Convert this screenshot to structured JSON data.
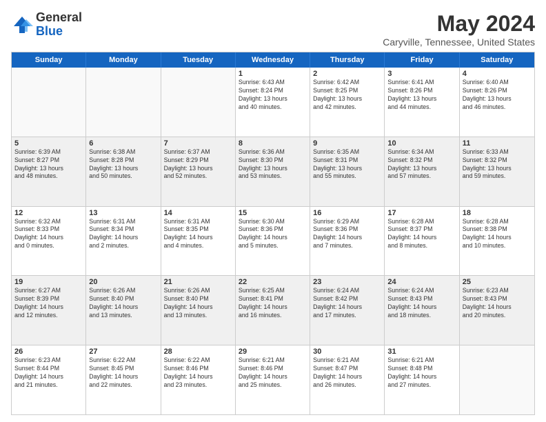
{
  "logo": {
    "general": "General",
    "blue": "Blue"
  },
  "title": "May 2024",
  "subtitle": "Caryville, Tennessee, United States",
  "header_days": [
    "Sunday",
    "Monday",
    "Tuesday",
    "Wednesday",
    "Thursday",
    "Friday",
    "Saturday"
  ],
  "weeks": [
    [
      {
        "day": "",
        "info": "",
        "empty": true
      },
      {
        "day": "",
        "info": "",
        "empty": true
      },
      {
        "day": "",
        "info": "",
        "empty": true
      },
      {
        "day": "1",
        "info": "Sunrise: 6:43 AM\nSunset: 8:24 PM\nDaylight: 13 hours\nand 40 minutes."
      },
      {
        "day": "2",
        "info": "Sunrise: 6:42 AM\nSunset: 8:25 PM\nDaylight: 13 hours\nand 42 minutes."
      },
      {
        "day": "3",
        "info": "Sunrise: 6:41 AM\nSunset: 8:26 PM\nDaylight: 13 hours\nand 44 minutes."
      },
      {
        "day": "4",
        "info": "Sunrise: 6:40 AM\nSunset: 8:26 PM\nDaylight: 13 hours\nand 46 minutes."
      }
    ],
    [
      {
        "day": "5",
        "info": "Sunrise: 6:39 AM\nSunset: 8:27 PM\nDaylight: 13 hours\nand 48 minutes."
      },
      {
        "day": "6",
        "info": "Sunrise: 6:38 AM\nSunset: 8:28 PM\nDaylight: 13 hours\nand 50 minutes."
      },
      {
        "day": "7",
        "info": "Sunrise: 6:37 AM\nSunset: 8:29 PM\nDaylight: 13 hours\nand 52 minutes."
      },
      {
        "day": "8",
        "info": "Sunrise: 6:36 AM\nSunset: 8:30 PM\nDaylight: 13 hours\nand 53 minutes."
      },
      {
        "day": "9",
        "info": "Sunrise: 6:35 AM\nSunset: 8:31 PM\nDaylight: 13 hours\nand 55 minutes."
      },
      {
        "day": "10",
        "info": "Sunrise: 6:34 AM\nSunset: 8:32 PM\nDaylight: 13 hours\nand 57 minutes."
      },
      {
        "day": "11",
        "info": "Sunrise: 6:33 AM\nSunset: 8:32 PM\nDaylight: 13 hours\nand 59 minutes."
      }
    ],
    [
      {
        "day": "12",
        "info": "Sunrise: 6:32 AM\nSunset: 8:33 PM\nDaylight: 14 hours\nand 0 minutes."
      },
      {
        "day": "13",
        "info": "Sunrise: 6:31 AM\nSunset: 8:34 PM\nDaylight: 14 hours\nand 2 minutes."
      },
      {
        "day": "14",
        "info": "Sunrise: 6:31 AM\nSunset: 8:35 PM\nDaylight: 14 hours\nand 4 minutes."
      },
      {
        "day": "15",
        "info": "Sunrise: 6:30 AM\nSunset: 8:36 PM\nDaylight: 14 hours\nand 5 minutes."
      },
      {
        "day": "16",
        "info": "Sunrise: 6:29 AM\nSunset: 8:36 PM\nDaylight: 14 hours\nand 7 minutes."
      },
      {
        "day": "17",
        "info": "Sunrise: 6:28 AM\nSunset: 8:37 PM\nDaylight: 14 hours\nand 8 minutes."
      },
      {
        "day": "18",
        "info": "Sunrise: 6:28 AM\nSunset: 8:38 PM\nDaylight: 14 hours\nand 10 minutes."
      }
    ],
    [
      {
        "day": "19",
        "info": "Sunrise: 6:27 AM\nSunset: 8:39 PM\nDaylight: 14 hours\nand 12 minutes."
      },
      {
        "day": "20",
        "info": "Sunrise: 6:26 AM\nSunset: 8:40 PM\nDaylight: 14 hours\nand 13 minutes."
      },
      {
        "day": "21",
        "info": "Sunrise: 6:26 AM\nSunset: 8:40 PM\nDaylight: 14 hours\nand 13 minutes."
      },
      {
        "day": "22",
        "info": "Sunrise: 6:25 AM\nSunset: 8:41 PM\nDaylight: 14 hours\nand 16 minutes."
      },
      {
        "day": "23",
        "info": "Sunrise: 6:24 AM\nSunset: 8:42 PM\nDaylight: 14 hours\nand 17 minutes."
      },
      {
        "day": "24",
        "info": "Sunrise: 6:24 AM\nSunset: 8:43 PM\nDaylight: 14 hours\nand 18 minutes."
      },
      {
        "day": "25",
        "info": "Sunrise: 6:23 AM\nSunset: 8:43 PM\nDaylight: 14 hours\nand 20 minutes."
      }
    ],
    [
      {
        "day": "26",
        "info": "Sunrise: 6:23 AM\nSunset: 8:44 PM\nDaylight: 14 hours\nand 21 minutes."
      },
      {
        "day": "27",
        "info": "Sunrise: 6:22 AM\nSunset: 8:45 PM\nDaylight: 14 hours\nand 22 minutes."
      },
      {
        "day": "28",
        "info": "Sunrise: 6:22 AM\nSunset: 8:46 PM\nDaylight: 14 hours\nand 23 minutes."
      },
      {
        "day": "29",
        "info": "Sunrise: 6:21 AM\nSunset: 8:46 PM\nDaylight: 14 hours\nand 25 minutes."
      },
      {
        "day": "30",
        "info": "Sunrise: 6:21 AM\nSunset: 8:47 PM\nDaylight: 14 hours\nand 26 minutes."
      },
      {
        "day": "31",
        "info": "Sunrise: 6:21 AM\nSunset: 8:48 PM\nDaylight: 14 hours\nand 27 minutes."
      },
      {
        "day": "",
        "info": "",
        "empty": true
      }
    ]
  ]
}
